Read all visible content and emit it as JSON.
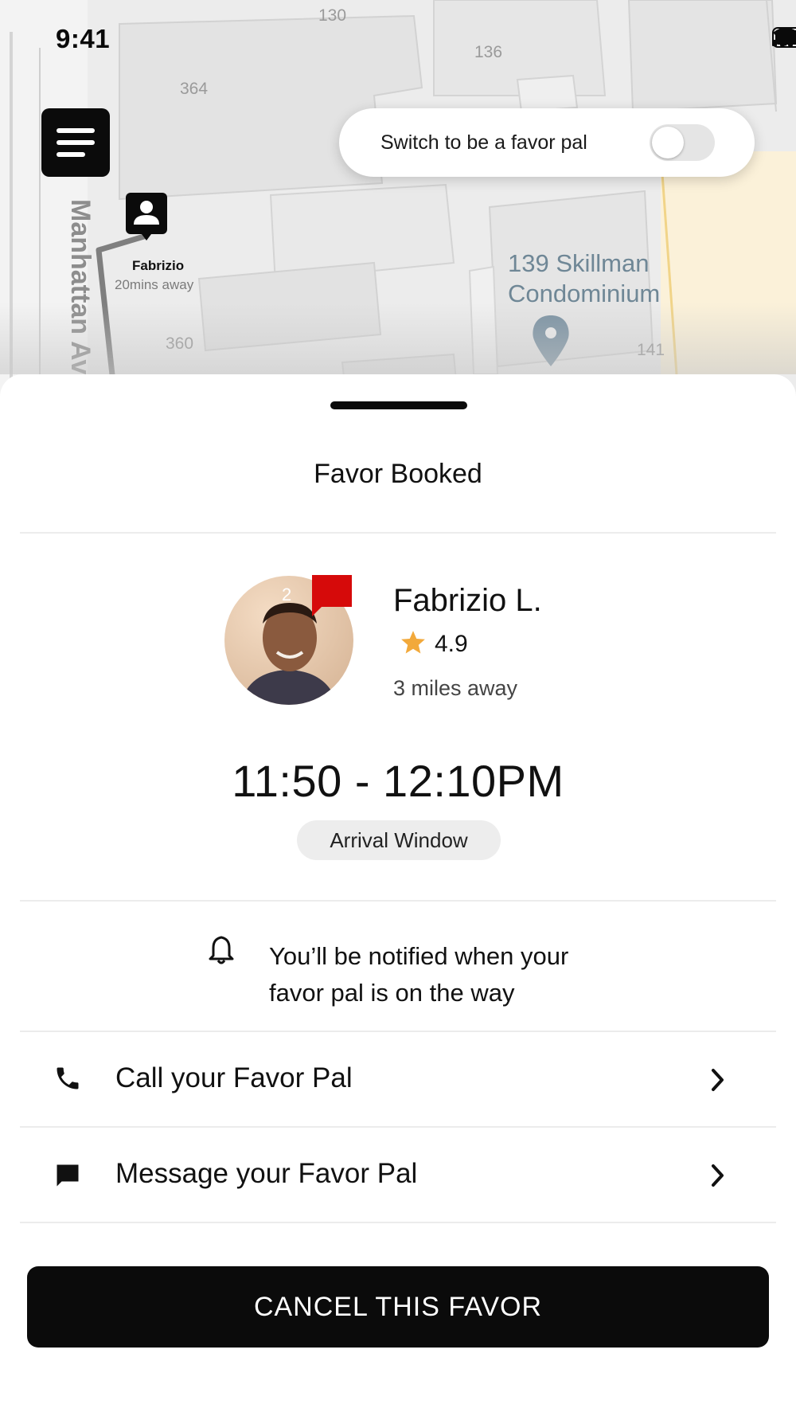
{
  "status_bar": {
    "time": "9:41"
  },
  "map": {
    "street_label": "Manhattan Av",
    "numbers": [
      "130",
      "136",
      "364",
      "360",
      "141"
    ],
    "poi": {
      "name_line1": "139 Skillman",
      "name_line2": "Condominium"
    },
    "driver_marker": {
      "name": "Fabrizio",
      "eta": "20mins away"
    }
  },
  "toggle": {
    "label": "Switch to be a favor pal",
    "on": false
  },
  "sheet": {
    "title": "Favor Booked",
    "pal": {
      "name": "Fabrizio L.",
      "rating": "4.9",
      "distance": "3 miles away",
      "message_count": "2"
    },
    "arrival": {
      "time": "11:50 - 12:10PM",
      "badge": "Arrival Window"
    },
    "notify": {
      "line1": "You’ll be notified when your",
      "line2": "favor pal is on the way"
    },
    "actions": [
      {
        "label": "Call your Favor Pal",
        "icon": "phone-icon"
      },
      {
        "label": "Message your Favor Pal",
        "icon": "message-icon"
      }
    ],
    "cancel_label": "CANCEL THIS FAVOR"
  },
  "colors": {
    "accent_black": "#0b0b0b",
    "badge_red": "#d60a0a",
    "star_gold": "#f2a93b",
    "poi_blue": "#6f8796"
  }
}
